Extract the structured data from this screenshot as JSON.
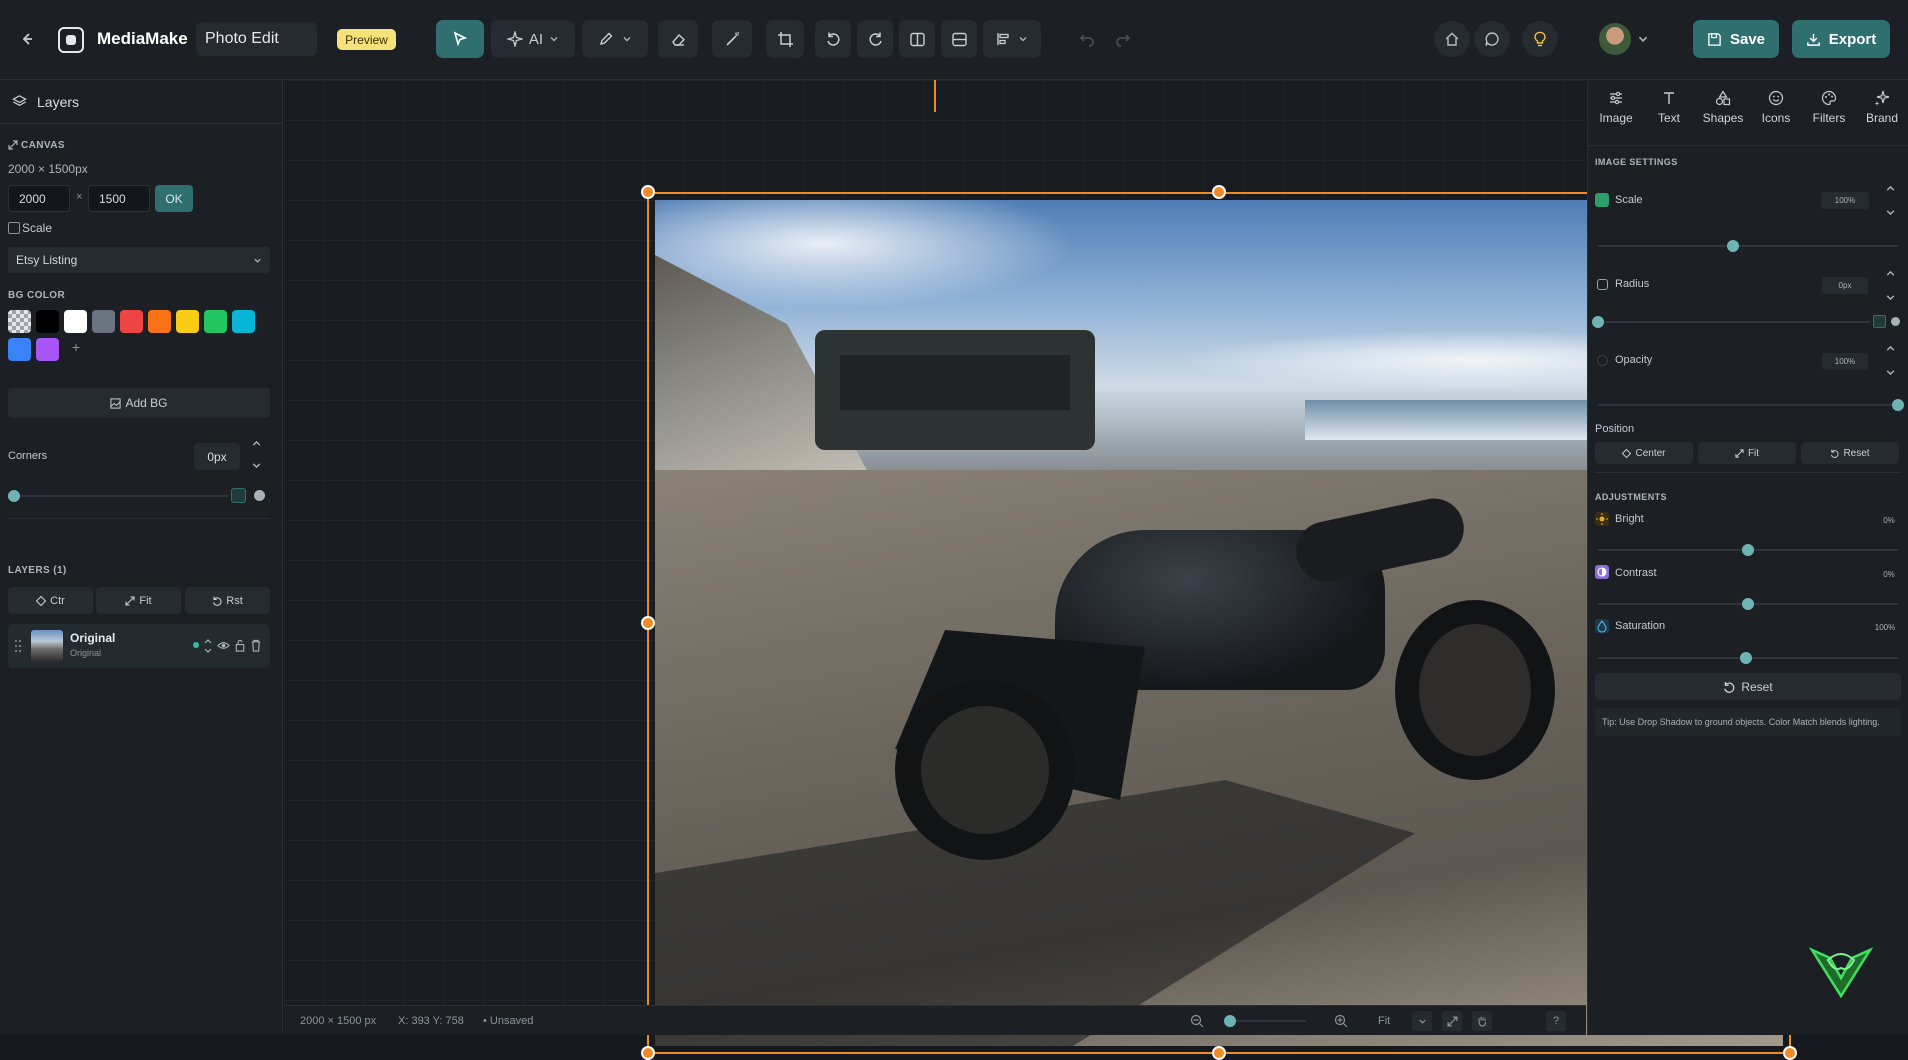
{
  "app": {
    "name": "MediaMake",
    "document_title": "Photo Edit",
    "badge": "Preview"
  },
  "toolbar": {
    "ai_label": "AI",
    "save_label": "Save",
    "export_label": "Export"
  },
  "left_panel": {
    "title": "Layers",
    "canvas_label": "CANVAS",
    "canvas_size": "2000 × 1500px",
    "width_value": "2000",
    "height_value": "1500",
    "times_sign": "×",
    "ok_label": "OK",
    "scale_label": "Scale",
    "preset": "Etsy Listing",
    "bg_color_label": "BG COLOR",
    "bg_colors": [
      "#000000",
      "#ffffff",
      "#6b7280",
      "#ef4444",
      "#f97316",
      "#facc15",
      "#22c55e",
      "#06b6d4",
      "#3b82f6",
      "#a855f7"
    ],
    "add_color_glyph": "+",
    "add_bg_label": "Add BG",
    "corners_label": "Corners",
    "corners_value": "0px",
    "layers_label": "LAYERS (1)",
    "ctr_label": "Ctr",
    "fit_label": "Fit",
    "rst_label": "Rst",
    "layer_name": "Original",
    "layer_subtitle": "Original"
  },
  "right_panel": {
    "tabs": [
      "Image",
      "Text",
      "Shapes",
      "Icons",
      "Filters",
      "Brand"
    ],
    "image_settings_label": "IMAGE SETTINGS",
    "scale_label": "Scale",
    "scale_value": "100%",
    "scale_level": 0.45,
    "radius_label": "Radius",
    "radius_value": "0px",
    "radius_level": 0.0,
    "opacity_label": "Opacity",
    "opacity_value": "100%",
    "opacity_level": 1.0,
    "position_label": "Position",
    "center_label": "Center",
    "fit_label": "Fit",
    "reset_label": "Reset",
    "adjustments_label": "ADJUSTMENTS",
    "bright_label": "Bright",
    "bright_value": "0%",
    "bright_level": 0.5,
    "contrast_label": "Contrast",
    "contrast_value": "0%",
    "contrast_level": 0.5,
    "saturation_label": "Saturation",
    "saturation_value": "100%",
    "saturation_level": 0.5,
    "reset_all_label": "Reset",
    "tip": "Tip: Use Drop Shadow to ground objects. Color Match blends lighting."
  },
  "status_bar": {
    "dimensions": "2000 × 1500 px",
    "cursor": "X: 393 Y: 758",
    "save_state": "• Unsaved",
    "zoom_mode": "Fit",
    "help": "?"
  },
  "colors": {
    "accent": "#2f6f6f",
    "selection": "#f08a24",
    "slider": "#6fb4b4"
  }
}
